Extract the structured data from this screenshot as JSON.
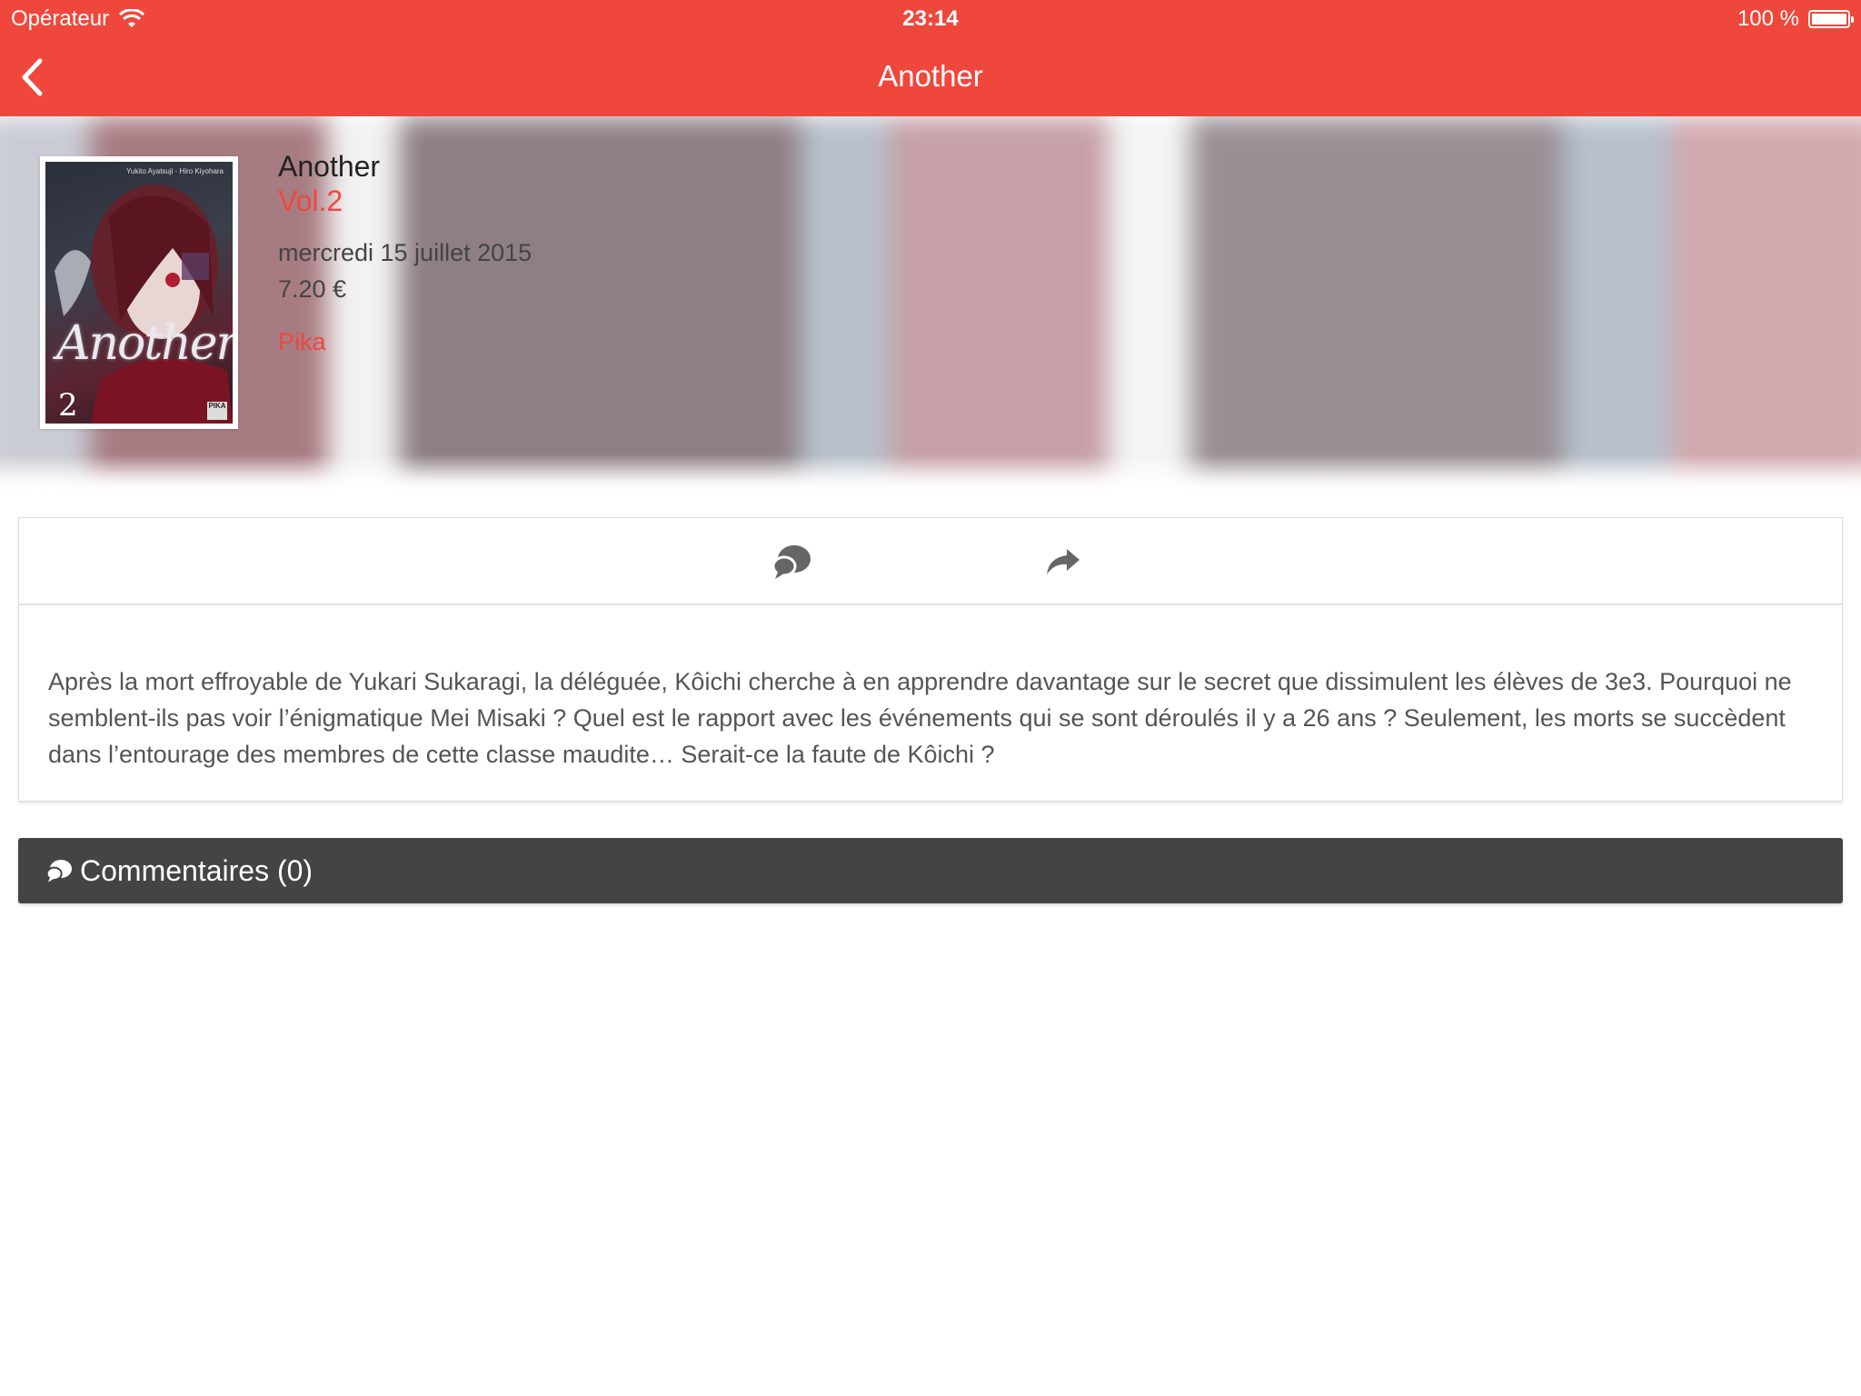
{
  "status_bar": {
    "carrier": "Opérateur",
    "time": "23:14",
    "battery": "100 %",
    "battery_level": 1.0
  },
  "nav": {
    "title": "Another",
    "back_icon": "chevron-left-icon"
  },
  "book": {
    "title": "Another",
    "volume": "Vol.2",
    "release_date": "mercredi 15 juillet 2015",
    "price": "7.20 €",
    "publisher": "Pika",
    "cover": {
      "title_text": "Another",
      "volume_number": "2",
      "credits": "Yukito Ayatsuji · Hiro Kiyohara",
      "logo": "PIKA"
    }
  },
  "actions": [
    {
      "name": "comments",
      "icon": "chat-bubble-icon"
    },
    {
      "name": "share",
      "icon": "share-arrow-icon"
    }
  ],
  "description": "Après la mort effroyable de Yukari Sukaragi, la déléguée, Kôichi cherche à en apprendre davantage sur le secret que dissimulent les élèves de 3e3. Pourquoi ne semblent-ils pas voir l’énigmatique Mei Misaki ? Quel est le rapport avec les événements qui se sont déroulés il y a 26 ans ? Seulement, les morts se succèdent dans l’entourage des membres de cette classe maudite… Serait-ce la faute de Kôichi ?",
  "comments": {
    "label": "Commentaires (0)",
    "icon": "chat-bubble-icon"
  },
  "colors": {
    "accent": "#f0473c",
    "comments_bar": "#444444",
    "text": "#555555"
  }
}
